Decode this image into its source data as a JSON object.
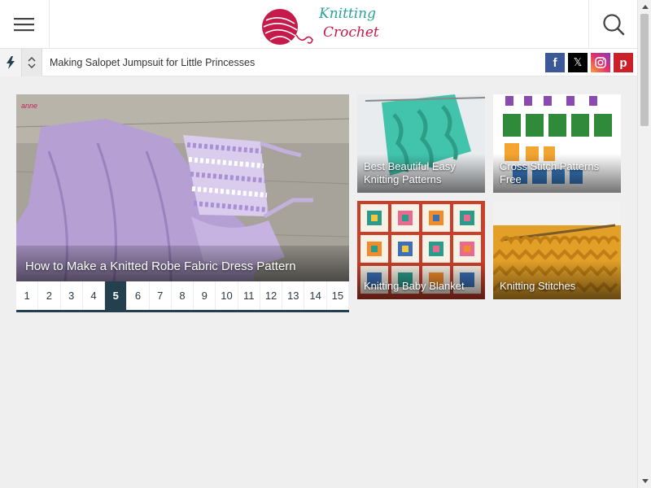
{
  "header": {
    "logo": {
      "line1": "Knitting",
      "line2": "Crochet"
    }
  },
  "ticker": {
    "headline": "Making Salopet Jumpsuit for Little Princesses"
  },
  "social": {
    "facebook": "f",
    "x": "𝕏",
    "pinterest": "p"
  },
  "featured": {
    "title": "How to Make a Knitted Robe Fabric Dress Pattern",
    "watermark": "anne"
  },
  "pagination": {
    "pages": [
      "1",
      "2",
      "3",
      "4",
      "5",
      "6",
      "7",
      "8",
      "9",
      "10",
      "11",
      "12",
      "13",
      "14",
      "15"
    ],
    "active": "5"
  },
  "cards": [
    {
      "title": "Best Beautiful Easy Knitting Patterns"
    },
    {
      "title": "Cross Stitch Patterns Free"
    },
    {
      "title": "Knitting Baby Blanket"
    },
    {
      "title": "Knitting Stitches"
    }
  ],
  "colors": {
    "accent": "#24404f",
    "brand_teal": "#2aa39a",
    "brand_red": "#c51a4a",
    "background": "#efefef"
  },
  "icons": [
    "menu-icon",
    "search-icon",
    "bolt-icon",
    "chevron-up-icon",
    "chevron-down-icon",
    "facebook-icon",
    "x-icon",
    "instagram-icon",
    "pinterest-icon"
  ]
}
